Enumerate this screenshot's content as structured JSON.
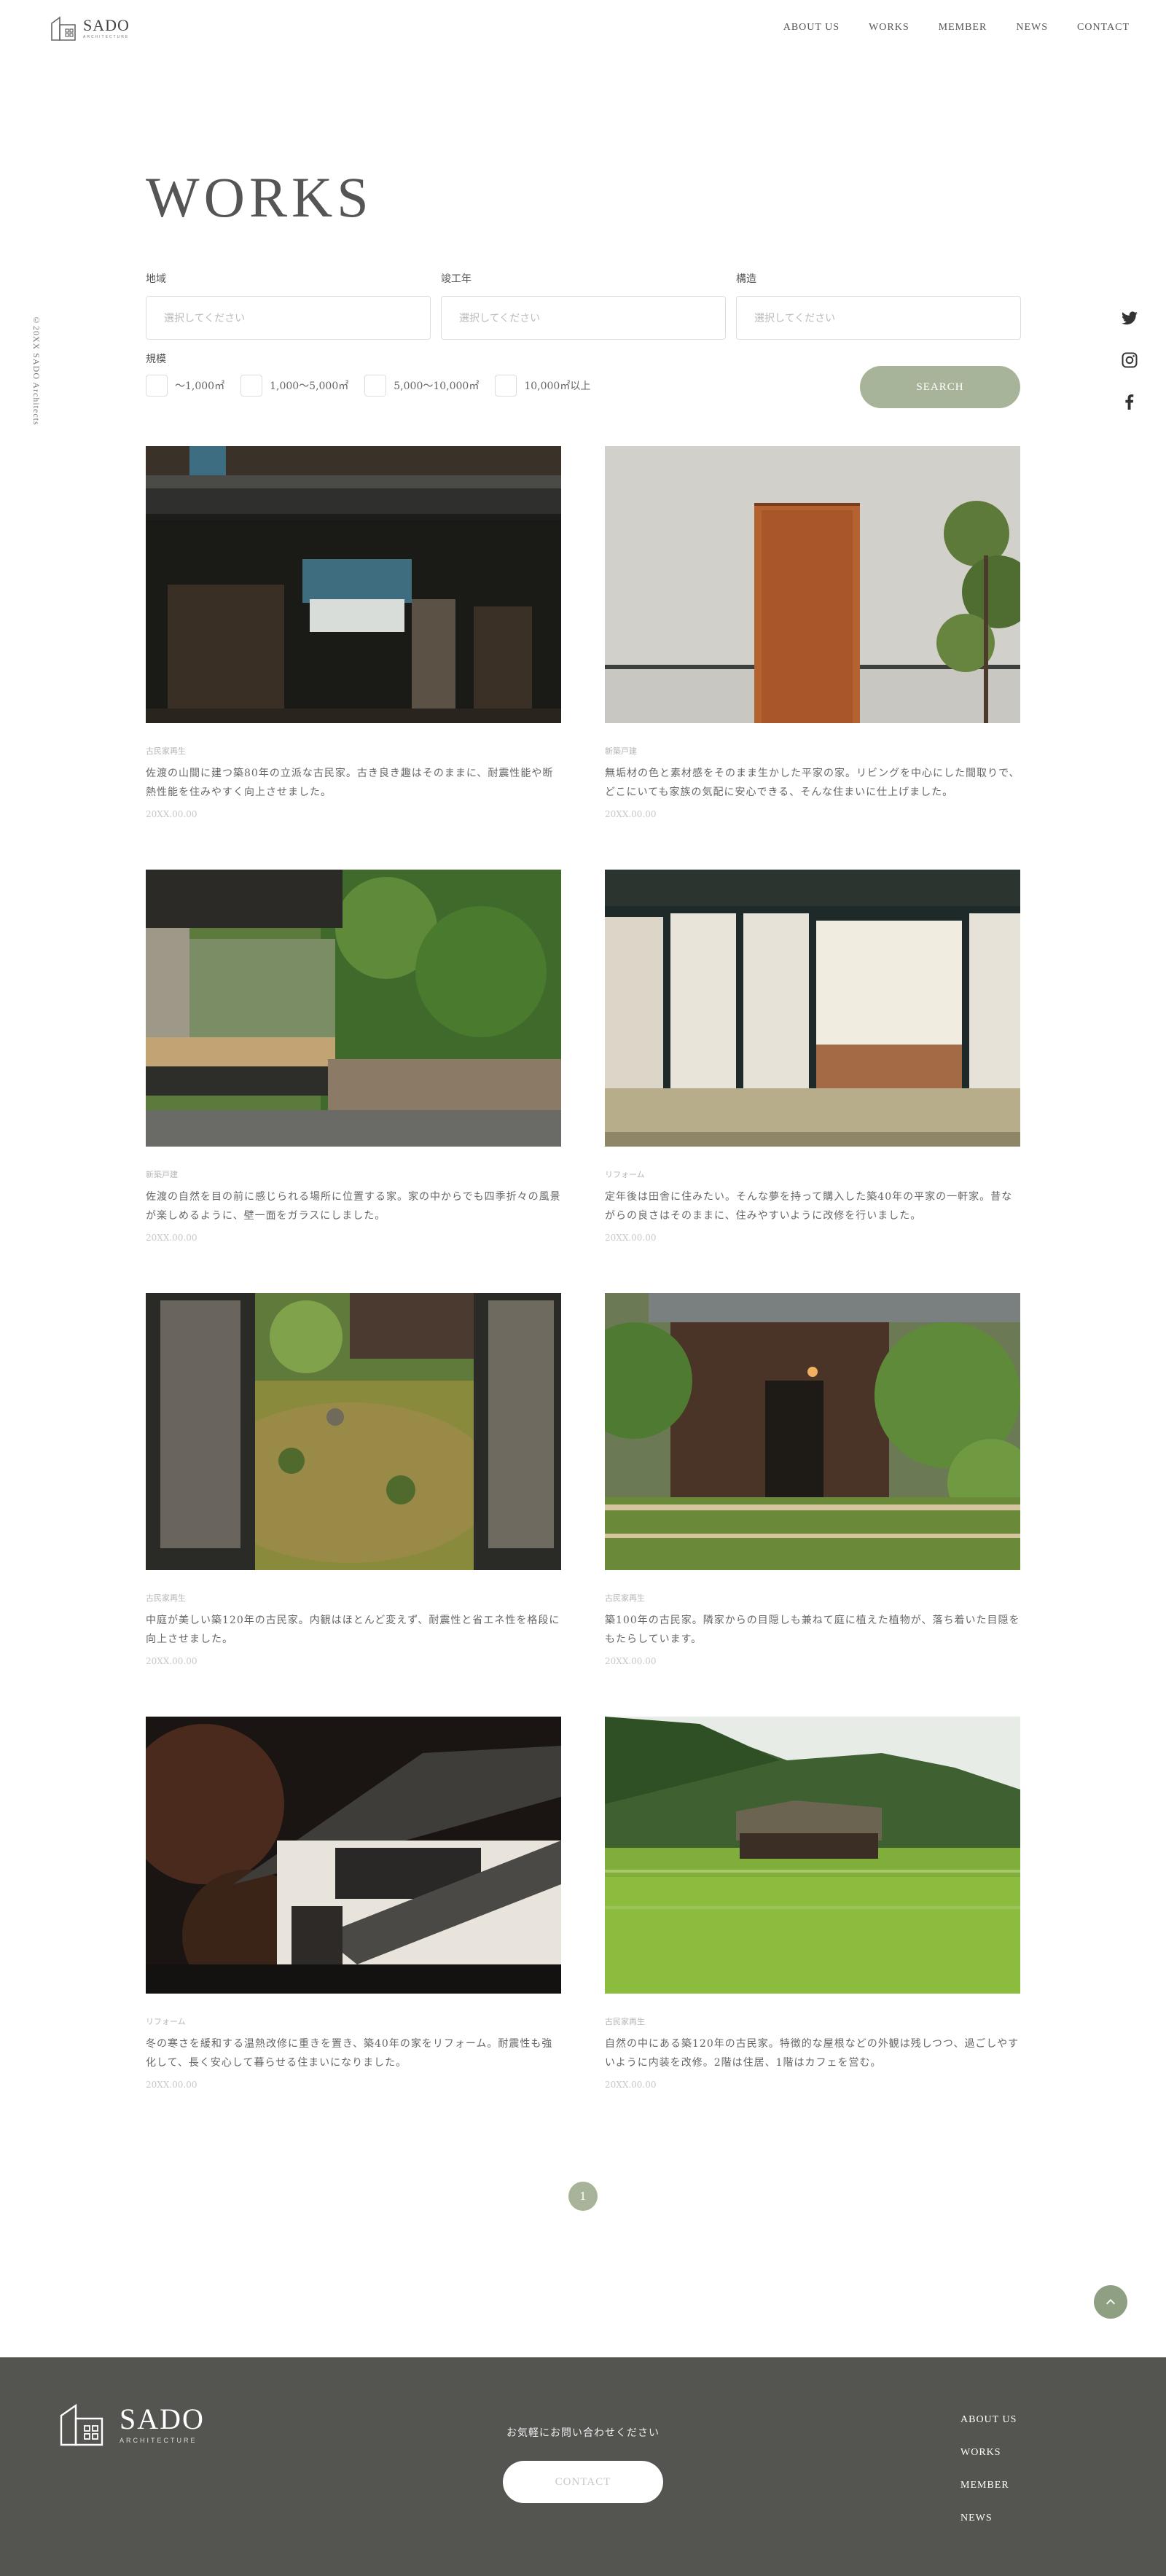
{
  "brand": {
    "name": "SADO",
    "sub": "ARCHITECTURE"
  },
  "nav": [
    "ABOUT US",
    "WORKS",
    "MEMBER",
    "NEWS",
    "CONTACT"
  ],
  "copyright": "©20XX SADO Architects",
  "page_title": "WORKS",
  "filters": {
    "region": {
      "label": "地域",
      "placeholder": "選択してください"
    },
    "year": {
      "label": "竣工年",
      "placeholder": "選択してください"
    },
    "structure": {
      "label": "構造",
      "placeholder": "選択してください"
    },
    "scale": {
      "label": "規模",
      "options": [
        "〜1,000㎡",
        "1,000〜5,000㎡",
        "5,000〜10,000㎡",
        "10,000㎡以上"
      ]
    },
    "search_label": "SEARCH"
  },
  "works": [
    {
      "category": "古民家再生",
      "description": "佐渡の山間に建つ築80年の立派な古民家。古き良き趣はそのままに、耐震性能や断熱性能を住みやすく向上させました。",
      "date": "20XX.00.00"
    },
    {
      "category": "新築戸建",
      "description": "無垢材の色と素材感をそのまま生かした平家の家。リビングを中心にした間取りで、どこにいても家族の気配に安心できる、そんな住まいに仕上げました。",
      "date": "20XX.00.00"
    },
    {
      "category": "新築戸建",
      "description": "佐渡の自然を目の前に感じられる場所に位置する家。家の中からでも四季折々の風景が楽しめるように、壁一面をガラスにしました。",
      "date": "20XX.00.00"
    },
    {
      "category": "リフォーム",
      "description": "定年後は田舎に住みたい。そんな夢を持って購入した築40年の平家の一軒家。昔ながらの良さはそのままに、住みやすいように改修を行いました。",
      "date": "20XX.00.00"
    },
    {
      "category": "古民家再生",
      "description": "中庭が美しい築120年の古民家。内観はほとんど変えず、耐震性と省エネ性を格段に向上させました。",
      "date": "20XX.00.00"
    },
    {
      "category": "古民家再生",
      "description": "築100年の古民家。隣家からの目隠しも兼ねて庭に植えた植物が、落ち着いた目隠をもたらしています。",
      "date": "20XX.00.00"
    },
    {
      "category": "リフォーム",
      "description": "冬の寒さを緩和する温熱改修に重きを置き、築40年の家をリフォーム。耐震性も強化して、長く安心して暮らせる住まいになりました。",
      "date": "20XX.00.00"
    },
    {
      "category": "古民家再生",
      "description": "自然の中にある築120年の古民家。特徴的な屋根などの外観は残しつつ、過ごしやすいように内装を改修。2階は住居、1階はカフェを営む。",
      "date": "20XX.00.00"
    }
  ],
  "pagination": {
    "current": "1"
  },
  "footer": {
    "inquiry": "お気軽にお問い合わせください",
    "contact_label": "CONTACT",
    "nav": [
      "ABOUT US",
      "WORKS",
      "MEMBER",
      "NEWS"
    ]
  },
  "colors": {
    "accent": "#a8b499",
    "footer_bg": "#545450",
    "text": "#555555"
  },
  "icons": [
    "logo-house-icon",
    "twitter-icon",
    "instagram-icon",
    "facebook-icon",
    "chevron-up-icon"
  ]
}
